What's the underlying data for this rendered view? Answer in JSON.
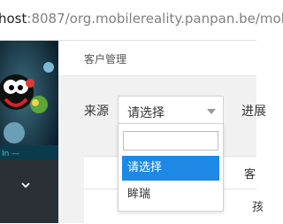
{
  "browser": {
    "url_host": "host",
    "url_rest": ":8087/org.mobilereality.panpan.be/mob"
  },
  "breadcrumb": "客户管理",
  "filters": {
    "source_label": "来源",
    "progress_label": "进展",
    "selected_value": "请选择"
  },
  "dropdown": {
    "search_value": "",
    "options": [
      "请选择",
      "眸瑞"
    ],
    "selected_index": 0
  },
  "table": {
    "header_cell": "客",
    "row_cell": "孩"
  },
  "colors": {
    "highlight": "#1e88e5",
    "sidebar": "#2a2e34"
  }
}
